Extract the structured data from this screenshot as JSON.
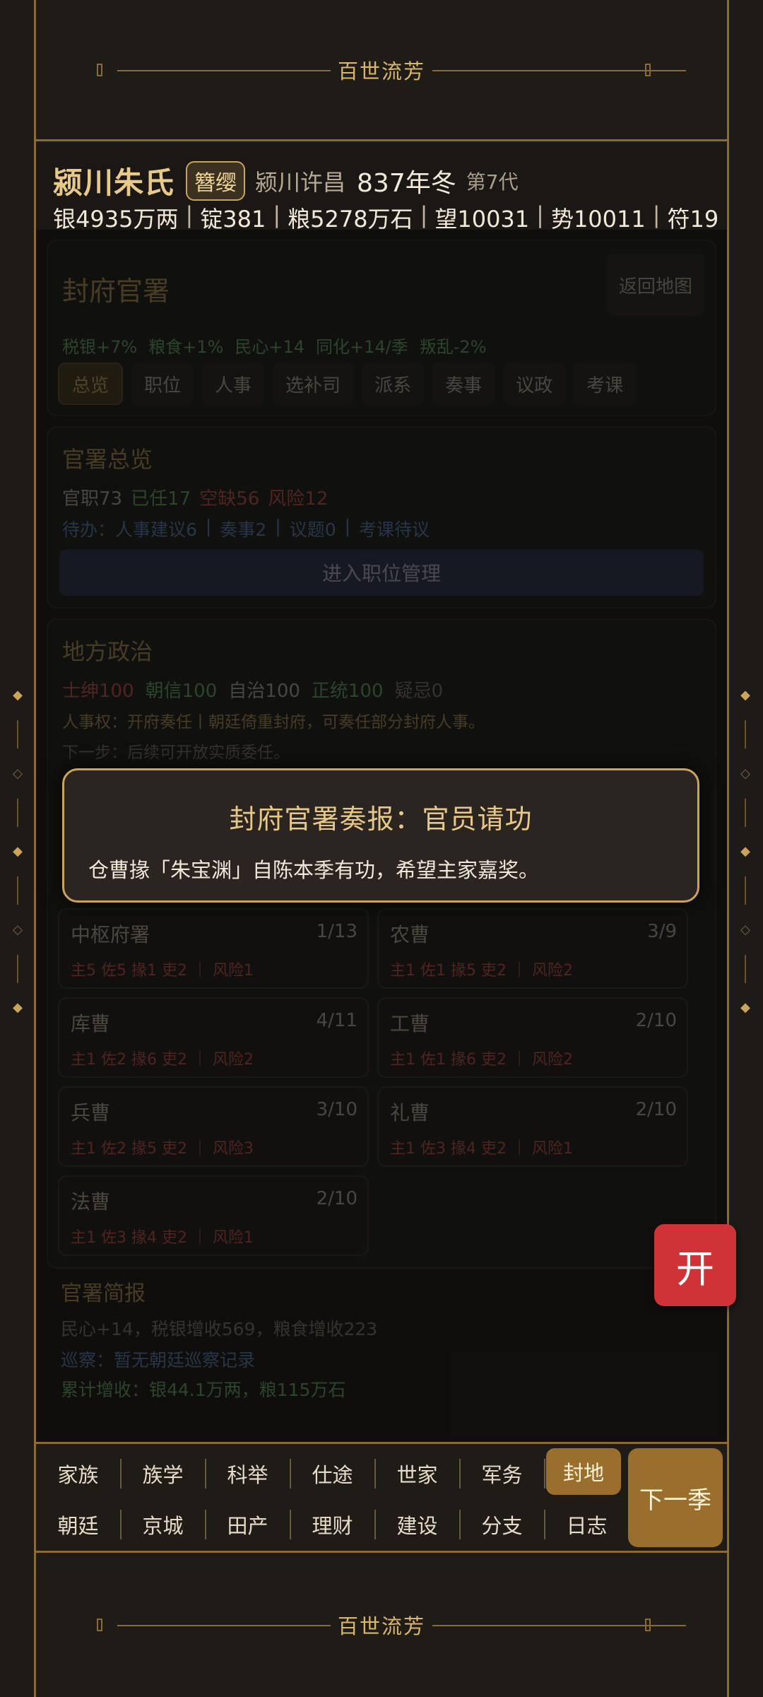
{
  "banner": {
    "title": "百世流芳"
  },
  "header": {
    "clan_name": "颍川朱氏",
    "rank_badge": "簪缨",
    "region": "颍川许昌",
    "date": "837年冬",
    "generation": "第7代",
    "resources": [
      "银4935万两",
      "锭381",
      "粮5278万石",
      "望10031",
      "势10011",
      "符19"
    ]
  },
  "office": {
    "title": "封府官署",
    "back_button": "返回地图",
    "bonuses": [
      "税银+7%",
      "粮食+1%",
      "民心+14",
      "同化+14/季",
      "叛乱-2%"
    ],
    "tabs": [
      "总览",
      "职位",
      "人事",
      "选补司",
      "派系",
      "奏事",
      "议政",
      "考课"
    ],
    "active_tab": "总览"
  },
  "overview": {
    "title": "官署总览",
    "posts": "官职73",
    "filled": "已任17",
    "vacant": "空缺56",
    "risk": "风险12",
    "todo": [
      "待办：人事建议6",
      "奏事2",
      "议题0",
      "考课待议"
    ],
    "enter_button": "进入职位管理"
  },
  "local": {
    "title": "地方政治",
    "stats": [
      {
        "text": "士绅100",
        "tone": "red"
      },
      {
        "text": "朝信100",
        "tone": "green"
      },
      {
        "text": "自治100",
        "tone": "gray"
      },
      {
        "text": "正统100",
        "tone": "green"
      },
      {
        "text": "疑忌0",
        "tone": "muted"
      }
    ],
    "line1": "人事权：开府奏任丨朝廷倚重封府，可奏任部分封府人事。",
    "line2": "下一步：后续可开放实质委任。",
    "departments": [
      {
        "name": "中枢府署",
        "count": "1/13",
        "detail": "主5 佐5 掾1 吏2 ｜ 风险1"
      },
      {
        "name": "农曹",
        "count": "3/9",
        "detail": "主1 佐1 掾5 吏2 ｜ 风险2"
      },
      {
        "name": "库曹",
        "count": "4/11",
        "detail": "主1 佐2 掾6 吏2 ｜ 风险2"
      },
      {
        "name": "工曹",
        "count": "2/10",
        "detail": "主1 佐1 掾6 吏2 ｜ 风险2"
      },
      {
        "name": "兵曹",
        "count": "3/10",
        "detail": "主1 佐2 掾5 吏2 ｜ 风险3"
      },
      {
        "name": "礼曹",
        "count": "2/10",
        "detail": "主1 佐3 掾4 吏2 ｜ 风险1"
      },
      {
        "name": "法曹",
        "count": "2/10",
        "detail": "主1 佐3 掾4 吏2 ｜ 风险1"
      }
    ]
  },
  "brief": {
    "title": "官署简报",
    "line1": "民心+14，税银增收569，粮食增收223",
    "line2": "巡察：暂无朝廷巡察记录",
    "line3": "累计增收：银44.1万两，粮115万石"
  },
  "modal": {
    "title": "封府官署奏报：官员请功",
    "body": "仓曹掾「朱宝渊」自陈本季有功，希望主家嘉奖。"
  },
  "float_button": {
    "label": "开"
  },
  "nav": {
    "row1": [
      "家族",
      "族学",
      "科举",
      "仕途",
      "世家",
      "军务",
      "封地"
    ],
    "row2": [
      "朝廷",
      "京城",
      "田产",
      "理财",
      "建设",
      "分支",
      "日志"
    ],
    "active": "封地",
    "next_button": "下一季"
  },
  "colors": {
    "gold": "#c9a45a",
    "accent_button": "#9a6e2c",
    "float_button": "#cf3338",
    "positive": "#6fbf6f",
    "negative": "#e05a4a",
    "info": "#5f8fcf"
  }
}
